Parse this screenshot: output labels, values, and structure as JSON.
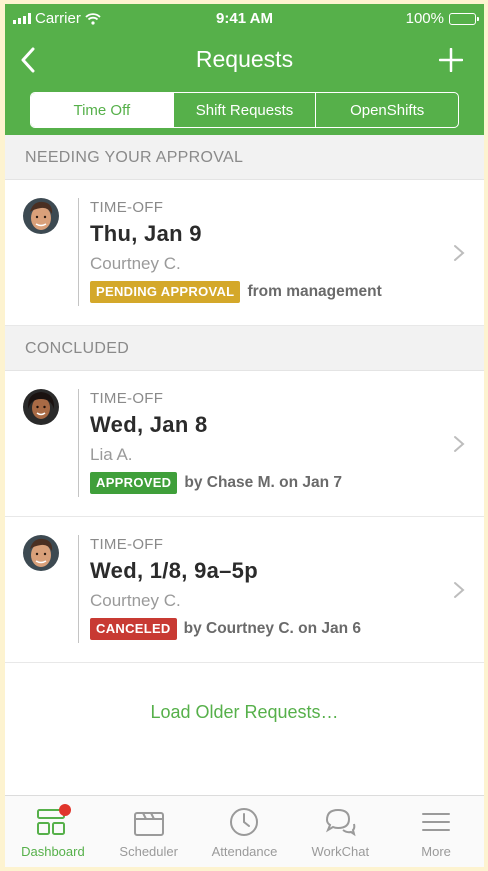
{
  "status_bar": {
    "carrier": "Carrier",
    "time": "9:41 AM",
    "battery": "100%"
  },
  "nav": {
    "title": "Requests"
  },
  "segments": [
    {
      "label": "Time Off",
      "active": true
    },
    {
      "label": "Shift Requests",
      "active": false
    },
    {
      "label": "OpenShifts",
      "active": false
    }
  ],
  "sections": {
    "pending": {
      "title": "NEEDING YOUR APPROVAL"
    },
    "concluded": {
      "title": "CONCLUDED"
    }
  },
  "requests": [
    {
      "type": "TIME-OFF",
      "date": "Thu, Jan 9",
      "person": "Courtney C.",
      "badge": "PENDING APPROVAL",
      "badge_color": "#d4a82a",
      "note": "from management"
    },
    {
      "type": "TIME-OFF",
      "date": "Wed, Jan 8",
      "person": "Lia A.",
      "badge": "APPROVED",
      "badge_color": "#3f9f3a",
      "note": "by Chase M. on Jan 7"
    },
    {
      "type": "TIME-OFF",
      "date": "Wed, 1/8, 9a–5p",
      "person": "Courtney C.",
      "badge": "CANCELED",
      "badge_color": "#c83a33",
      "note": "by Courtney C. on Jan 6"
    }
  ],
  "load_older": "Load Older Requests…",
  "tabbar": [
    {
      "label": "Dashboard",
      "icon": "dashboard-icon",
      "active": true
    },
    {
      "label": "Scheduler",
      "icon": "scheduler-icon",
      "active": false
    },
    {
      "label": "Attendance",
      "icon": "clock-icon",
      "active": false
    },
    {
      "label": "WorkChat",
      "icon": "chat-icon",
      "active": false
    },
    {
      "label": "More",
      "icon": "menu-icon",
      "active": false
    }
  ],
  "colors": {
    "brand": "#56b04a",
    "notification": "#e0352b"
  }
}
